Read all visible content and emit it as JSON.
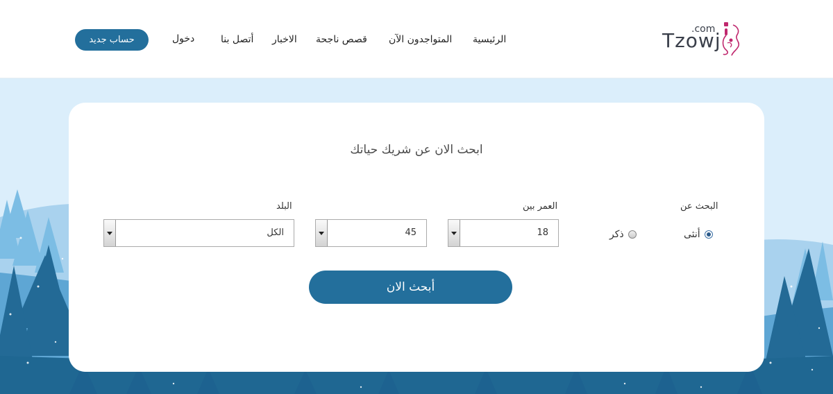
{
  "logo": {
    "brand": "Tzowj",
    "suffix": ".com"
  },
  "nav": {
    "home": "الرئيسية",
    "online": "المتواجدون الآن",
    "stories": "قصص ناجحة",
    "news": "الاخبار",
    "contact": "أتصل بنا",
    "login": "دخول",
    "register": "حساب جديد"
  },
  "colors": {
    "accent": "#236f9c",
    "sky": "#dbeefb",
    "tree_dark": "#1f6792",
    "tree_light": "#7cbde4"
  },
  "search": {
    "title": "ابحث الان عن شريك حياتك",
    "looking_for_label": "البحث عن",
    "options": {
      "female": "أنثى",
      "male": "ذكر"
    },
    "selected": "female",
    "age_label": "العمر بين",
    "age_from": "18",
    "age_to": "45",
    "country_label": "البلد",
    "country": "الكل",
    "button": "أبحث الان"
  }
}
